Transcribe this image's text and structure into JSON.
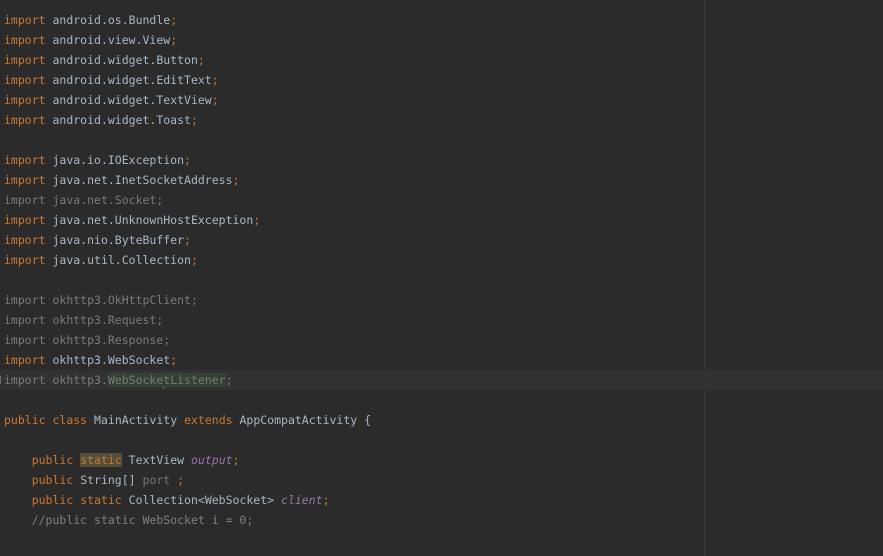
{
  "imports_android": [
    {
      "kw": "import",
      "pkg": "android.os.Bundle",
      "semi": ";"
    },
    {
      "kw": "import",
      "pkg": "android.view.View",
      "semi": ";"
    },
    {
      "kw": "import",
      "pkg": "android.widget.Button",
      "semi": ";"
    },
    {
      "kw": "import",
      "pkg": "android.widget.EditText",
      "semi": ";"
    },
    {
      "kw": "import",
      "pkg": "android.widget.TextView",
      "semi": ";"
    },
    {
      "kw": "import",
      "pkg": "android.widget.Toast",
      "semi": ";"
    }
  ],
  "imports_java": [
    {
      "kw": "import",
      "pkg": "java.io.IOException",
      "semi": ";"
    },
    {
      "kw": "import",
      "pkg": "java.net.InetSocketAddress",
      "semi": ";"
    },
    {
      "kw": "import",
      "pkg": "java.net.Socket",
      "semi": ";"
    },
    {
      "kw": "import",
      "pkg": "java.net.UnknownHostException",
      "semi": ";"
    },
    {
      "kw": "import",
      "pkg": "java.nio.ByteBuffer",
      "semi": ";"
    },
    {
      "kw": "import",
      "pkg": "java.util.Collection",
      "semi": ";"
    }
  ],
  "imports_okhttp": [
    {
      "kw": "import",
      "pkg": "okhttp3.OkHttpClient",
      "semi": ";"
    },
    {
      "kw": "import",
      "pkg": "okhttp3.Request",
      "semi": ";"
    },
    {
      "kw": "import",
      "pkg": "okhttp3.Response",
      "semi": ";"
    },
    {
      "kw": "import",
      "pkg": "okhttp3.WebSocket",
      "semi": ";"
    },
    {
      "kw": "import",
      "pkg_before": "okhttp3.",
      "pkg_hl_a": "WebSocke",
      "pkg_hl_b": "tListener",
      "semi": ";"
    }
  ],
  "class_decl": {
    "public": "public",
    "class": "class",
    "name": "MainActivity",
    "extends": "extends",
    "parent": "AppCompatActivity",
    "brace": "{"
  },
  "fields": {
    "f1": {
      "public": "public",
      "static": "static",
      "type": "TextView",
      "name": "output",
      "semi": ";"
    },
    "f2": {
      "public": "public",
      "type": "String[]",
      "name": "port",
      "semi": ";"
    },
    "f3": {
      "public": "public",
      "static": "static",
      "type": "Collection<WebSocket>",
      "name": "client",
      "semi": ";"
    },
    "f4_comment": "//public static WebSocket i = 0;"
  }
}
